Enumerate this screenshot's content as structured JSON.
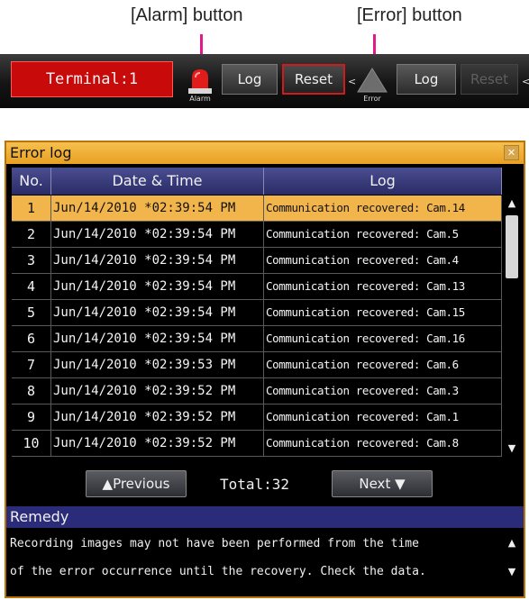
{
  "annotations": {
    "alarm_button": "[Alarm] button",
    "error_button": "[Error] button"
  },
  "statusbar": {
    "terminal": "Terminal:1",
    "alarm_caption": "Alarm",
    "alarm_log": "Log",
    "alarm_reset": "Reset",
    "error_caption": "Error",
    "error_log": "Log",
    "error_reset": "Reset"
  },
  "error_log": {
    "title": "Error log",
    "columns": [
      "No.",
      "Date & Time",
      "Log"
    ],
    "rows": [
      {
        "no": "1",
        "date_time": "Jun/14/2010  *02:39:54 PM",
        "log": "Communication recovered: Cam.14",
        "selected": true
      },
      {
        "no": "2",
        "date_time": "Jun/14/2010  *02:39:54 PM",
        "log": "Communication recovered: Cam.5"
      },
      {
        "no": "3",
        "date_time": "Jun/14/2010  *02:39:54 PM",
        "log": "Communication recovered: Cam.4"
      },
      {
        "no": "4",
        "date_time": "Jun/14/2010  *02:39:54 PM",
        "log": "Communication recovered: Cam.13"
      },
      {
        "no": "5",
        "date_time": "Jun/14/2010  *02:39:54 PM",
        "log": "Communication recovered: Cam.15"
      },
      {
        "no": "6",
        "date_time": "Jun/14/2010  *02:39:54 PM",
        "log": "Communication recovered: Cam.16"
      },
      {
        "no": "7",
        "date_time": "Jun/14/2010  *02:39:53 PM",
        "log": "Communication recovered: Cam.6"
      },
      {
        "no": "8",
        "date_time": "Jun/14/2010  *02:39:52 PM",
        "log": "Communication recovered: Cam.3"
      },
      {
        "no": "9",
        "date_time": "Jun/14/2010  *02:39:52 PM",
        "log": "Communication recovered: Cam.1"
      },
      {
        "no": "10",
        "date_time": "Jun/14/2010  *02:39:52 PM",
        "log": "Communication recovered: Cam.8"
      }
    ],
    "previous_label": "▲Previous",
    "total": "Total:32",
    "next_label": "Next ▼",
    "remedy_title": "Remedy",
    "remedy_lines": [
      "Recording images may not have been performed from the time",
      "of the error occurrence until the recovery. Check the data."
    ]
  },
  "colors": {
    "title_bar": "#e8a022",
    "selected_row": "#f2b54b",
    "header_blue": "#2a2c66",
    "terminal_red": "#c80a0a",
    "leader_pink": "#e0198c"
  }
}
